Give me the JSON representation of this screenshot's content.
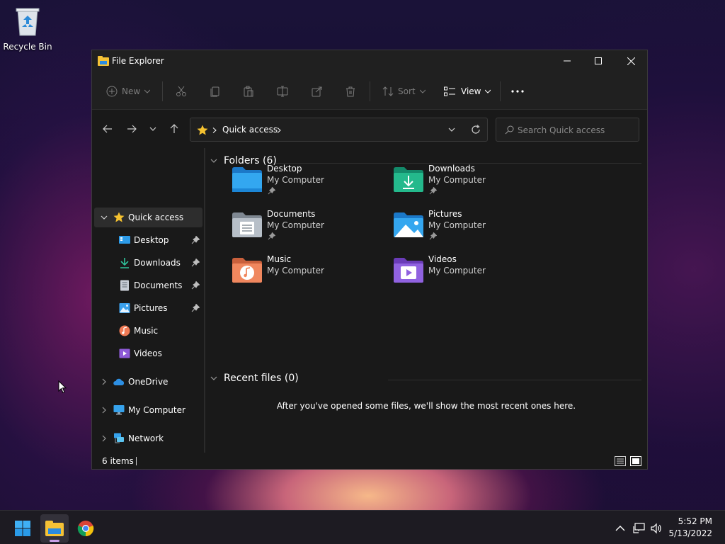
{
  "desktop": {
    "icons": [
      {
        "label": "Recycle Bin",
        "icon": "recycle-bin-icon"
      }
    ]
  },
  "window": {
    "title": "File Explorer",
    "controls": [
      "minimize",
      "maximize",
      "close"
    ]
  },
  "command_bar": {
    "new_label": "New",
    "sort_label": "Sort",
    "view_label": "View",
    "icons": [
      "cut-icon",
      "copy-icon",
      "paste-icon",
      "rename-icon",
      "share-icon",
      "delete-icon"
    ]
  },
  "address_bar": {
    "location": "Quick access",
    "search_placeholder": "Search Quick access"
  },
  "sidebar": {
    "quick_access": "Quick access",
    "pinned": [
      {
        "label": "Desktop",
        "pinned": true
      },
      {
        "label": "Downloads",
        "pinned": true
      },
      {
        "label": "Documents",
        "pinned": true
      },
      {
        "label": "Pictures",
        "pinned": true
      },
      {
        "label": "Music",
        "pinned": false
      },
      {
        "label": "Videos",
        "pinned": false
      }
    ],
    "roots": [
      {
        "label": "OneDrive"
      },
      {
        "label": "My Computer"
      },
      {
        "label": "Network"
      }
    ]
  },
  "content": {
    "folders_header": "Folders (6)",
    "folders": [
      {
        "name": "Desktop",
        "location": "My Computer",
        "pinned": true
      },
      {
        "name": "Downloads",
        "location": "My Computer",
        "pinned": true
      },
      {
        "name": "Documents",
        "location": "My Computer",
        "pinned": true
      },
      {
        "name": "Pictures",
        "location": "My Computer",
        "pinned": true
      },
      {
        "name": "Music",
        "location": "My Computer",
        "pinned": false
      },
      {
        "name": "Videos",
        "location": "My Computer",
        "pinned": false
      }
    ],
    "recent_header": "Recent files (0)",
    "recent_empty_message": "After you've opened some files, we'll show the most recent ones here."
  },
  "status_bar": {
    "item_count": "6 items"
  },
  "taskbar": {
    "apps": [
      "start-icon",
      "file-explorer-icon",
      "chrome-icon"
    ],
    "time": "5:52 PM",
    "date": "5/13/2022"
  },
  "colors": {
    "accent": "#0078d4",
    "window_bg": "#191919",
    "chrome_bg": "#202020"
  }
}
